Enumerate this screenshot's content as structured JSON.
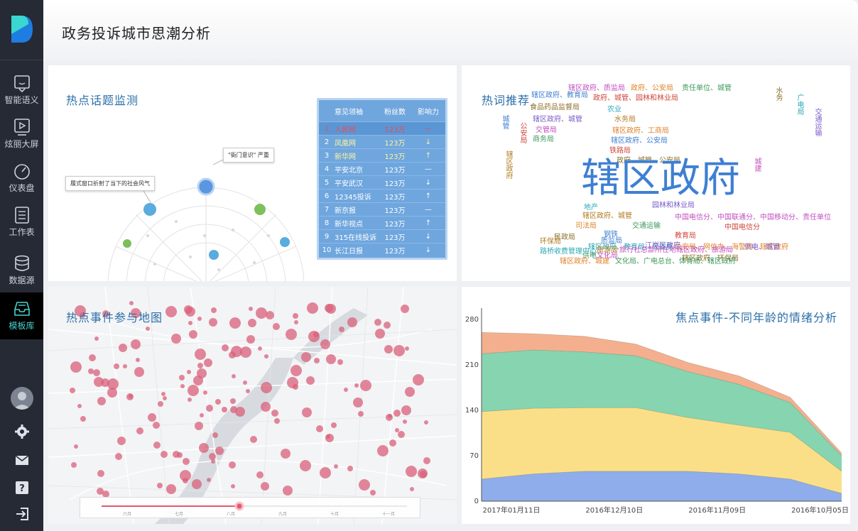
{
  "page_title": "政务投诉城市思潮分析",
  "sidebar": {
    "items": [
      {
        "label": "智能语义",
        "icon": "chat-face-icon"
      },
      {
        "label": "炫丽大屏",
        "icon": "play-screen-icon"
      },
      {
        "label": "仪表盘",
        "icon": "gauge-icon"
      },
      {
        "label": "工作表",
        "icon": "worksheet-icon"
      },
      {
        "label": "数据源",
        "icon": "database-icon"
      },
      {
        "label": "模板库",
        "icon": "template-tray-icon"
      }
    ],
    "active": "模板库",
    "bottom_icons": [
      "avatar",
      "gear-icon",
      "mail-icon",
      "help-icon",
      "logout-icon"
    ]
  },
  "panels": {
    "hot_topic": {
      "title": "热点话题监测",
      "table": {
        "headers": [
          "意见领袖",
          "粉丝数",
          "影响力"
        ],
        "rows": [
          {
            "idx": "1",
            "name": "人民网",
            "fans": "123万",
            "trend": "—"
          },
          {
            "idx": "2",
            "name": "凤凰网",
            "fans": "123万",
            "trend": "↓"
          },
          {
            "idx": "3",
            "name": "新华网",
            "fans": "123万",
            "trend": "↑"
          },
          {
            "idx": "4",
            "name": "平安北京",
            "fans": "123万",
            "trend": "—"
          },
          {
            "idx": "5",
            "name": "平安武汉",
            "fans": "123万",
            "trend": "↓"
          },
          {
            "idx": "6",
            "name": "12345投诉",
            "fans": "123万",
            "trend": "↑"
          },
          {
            "idx": "7",
            "name": "新京报",
            "fans": "123万",
            "trend": "—"
          },
          {
            "idx": "8",
            "name": "新华视点",
            "fans": "123万",
            "trend": "↑"
          },
          {
            "idx": "9",
            "name": "315在线投诉",
            "fans": "123万",
            "trend": "↓"
          },
          {
            "idx": "10",
            "name": "长江日报",
            "fans": "123万",
            "trend": "↓"
          }
        ]
      },
      "tooltip_1": "\"衙门意识\" 严重",
      "tooltip_2": "履式窗口折射了当下的社会风气"
    },
    "hot_words": {
      "title": "热词推荐",
      "big_word": "辖区政府",
      "words": [
        "辖区政府、质监局",
        "政府、公安局",
        "责任单位、城管",
        "辖区政府、教育局",
        "政府、城管、园林和林业局",
        "食品药品监督局",
        "农业",
        "辖区政府、城管",
        "水务局",
        "交管局",
        "辖区政府、工商局",
        "商务局",
        "辖区政府、公安局",
        "铁路局",
        "政府、城管、公安局",
        "地产",
        "园林和林业局",
        "辖区政府、城管",
        "中国电信分、中国联通分、中国移动分、责任单位",
        "司法局",
        "交通运输",
        "钢铁",
        "中国电信分",
        "民政局",
        "辖区政府、教育局、公安局",
        "江岸区政府",
        "环保局",
        "文化局",
        "公安局、网信办、海警局、辖区政府",
        "供电",
        "质监局",
        "教育局",
        "辖区政府、环保局",
        "路桥收费管理中心",
        "供电、城管",
        "旅游局",
        "旅行社总部所在地辖区政府、旅游局",
        "辖区政府、城建",
        "文化局、广电总台、体育局、辖区政府",
        "城管",
        "公安局",
        "水务",
        "广电局",
        "交通运输",
        "辖区政府",
        "城建"
      ]
    },
    "map": {
      "title": "热点事件参与地图",
      "timeline_labels": [
        "六月",
        "七月",
        "八月",
        "九月",
        "十月",
        "十一月"
      ]
    },
    "emotion": {
      "title": "焦点事件-不同年龄的情绪分析"
    }
  },
  "chart_data": {
    "type": "area",
    "title": "焦点事件-不同年龄的情绪分析",
    "categories": [
      "2017年01月11日",
      "",
      "2016年12月10日",
      "",
      "2016年11月09日",
      "",
      "2016年10月05日",
      ""
    ],
    "x_tick_labels": [
      "2017年01月11日",
      "2016年12月10日",
      "2016年11月09日",
      "2016年10月05日"
    ],
    "ylim": [
      0,
      280
    ],
    "yticks": [
      0,
      70,
      140,
      210,
      280
    ],
    "stacked": true,
    "series": [
      {
        "color": "#8fadea",
        "values": [
          34,
          42,
          46,
          46,
          46,
          42,
          34,
          12
        ]
      },
      {
        "color": "#fbdf88",
        "values": [
          104,
          101,
          98,
          98,
          83,
          75,
          72,
          34
        ]
      },
      {
        "color": "#86d4b0",
        "values": [
          89,
          90,
          86,
          80,
          71,
          63,
          46,
          24
        ]
      },
      {
        "color": "#f4b08e",
        "values": [
          33,
          25,
          24,
          18,
          14,
          13,
          8,
          4
        ]
      }
    ],
    "grid": false
  }
}
